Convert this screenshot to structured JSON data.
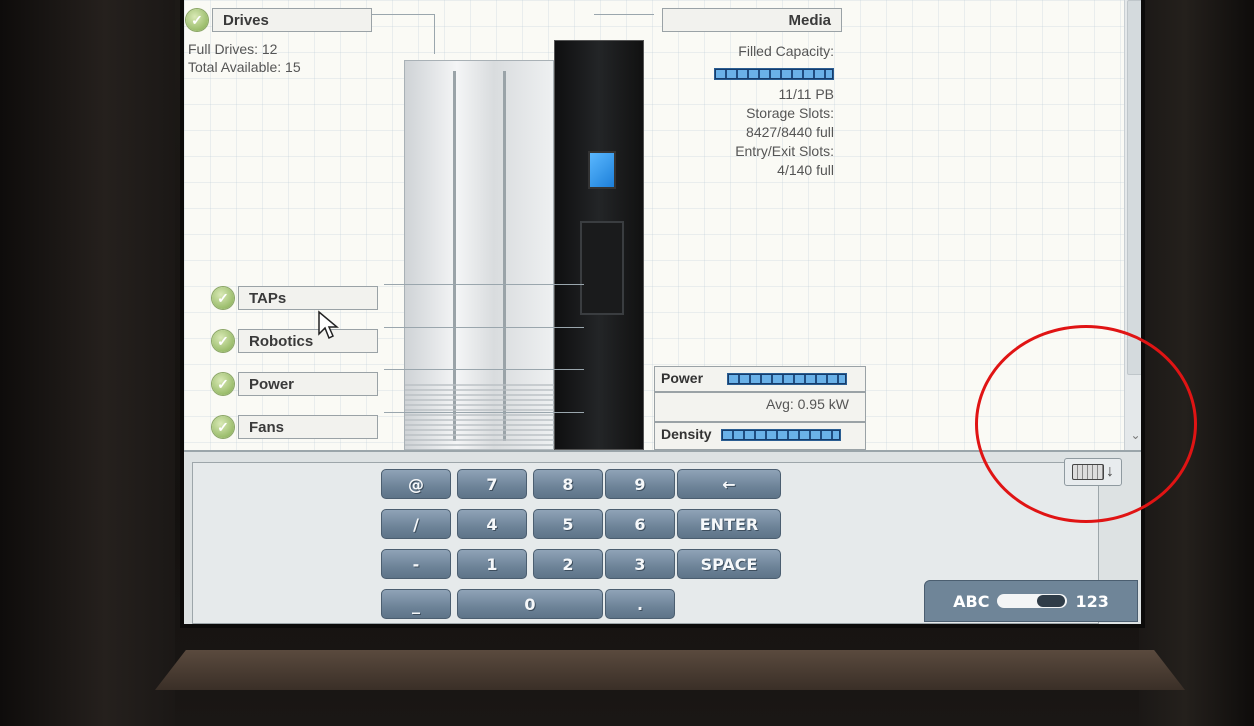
{
  "status": {
    "drives": {
      "label": "Drives",
      "full": "Full Drives: 12",
      "total": "Total Available: 15"
    },
    "media": {
      "label": "Media",
      "filled_label": "Filled Capacity:",
      "filled_fraction": 1.0,
      "filled_value": "11/11 PB",
      "storage_label": "Storage Slots:",
      "storage_value": "8427/8440 full",
      "entry_label": "Entry/Exit Slots:",
      "entry_value": "4/140 full"
    },
    "taps": "TAPs",
    "robotics": "Robotics",
    "power_status": "Power",
    "fans": "Fans",
    "power_meter": {
      "label": "Power",
      "fraction": 1.0,
      "avg": "Avg: 0.95 kW"
    },
    "density_meter": {
      "label": "Density",
      "fraction": 1.0
    }
  },
  "keypad": {
    "rows": [
      [
        "@",
        "7",
        "8",
        "9",
        "←"
      ],
      [
        "/",
        "4",
        "5",
        "6",
        "ENTER"
      ],
      [
        "-",
        "1",
        "2",
        "3",
        "SPACE"
      ],
      [
        "_",
        "0",
        "."
      ]
    ],
    "mode_left": "ABC",
    "mode_right": "123"
  },
  "icons": {
    "check": "check-icon",
    "cursor": "pointer-cursor-icon",
    "hide_keyboard": "keyboard-hide-icon",
    "scroll_down": "chevron-down-icon"
  },
  "colors": {
    "ok_green": "#9bbd6c",
    "key_blue": "#6d8398",
    "gauge_fill": "#6ab1e8",
    "annotation_red": "#e01414"
  }
}
